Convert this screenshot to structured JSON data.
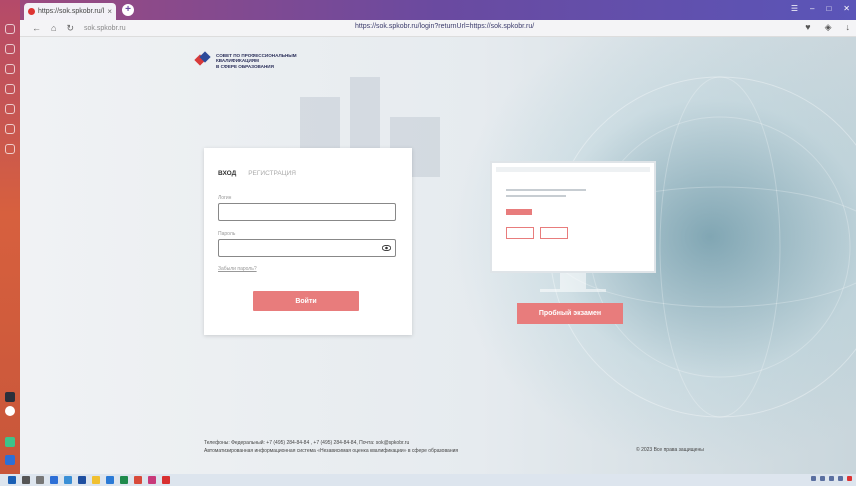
{
  "browser": {
    "tab_title": "https://sok.spkobr.ru/l",
    "address_short": "sok.spkobr.ru",
    "url": "https://sok.spkobr.ru/login?returnUrl=https://sok.spkobr.ru/",
    "new_tab_symbol": "+",
    "tab_close_symbol": "×"
  },
  "logo": {
    "line1": "СОВЕТ ПО ПРОФЕССИОНАЛЬНЫМ",
    "line2": "КВАЛИФИКАЦИЯМ",
    "line3": "В СФЕРЕ ОБРАЗОВАНИЯ"
  },
  "login_card": {
    "tab_login": "ВХОД",
    "tab_register": "РЕГИСТРАЦИЯ",
    "login_label": "Логин",
    "password_label": "Пароль",
    "forgot_link": "Забыли пароль?",
    "submit": "Войти"
  },
  "trial_button": "Пробный экзамен",
  "footer": {
    "line1": "Телефоны: Федеральный: +7 (495) 284-84-84 , +7 (495) 284-84-84, Почта: sok@spkobr.ru",
    "line2": "Автоматизированная информационная система «Независимая оценка квалификации» в сфере образования",
    "copyright": "© 2023 Все права защищены"
  },
  "colors": {
    "accent_button": "#e87c7c",
    "logo_text": "#2b2f5a",
    "sidebar_top": "#b44a6a",
    "tabbar": "#6a4aa0"
  },
  "icons": [
    "account-icon",
    "home-icon",
    "history-icon",
    "favorites-icon",
    "settings-icon",
    "back-icon",
    "reload-icon",
    "home-nav-icon",
    "bookmark-icon",
    "extensions-icon",
    "eye-icon",
    "windows-start-icon"
  ]
}
